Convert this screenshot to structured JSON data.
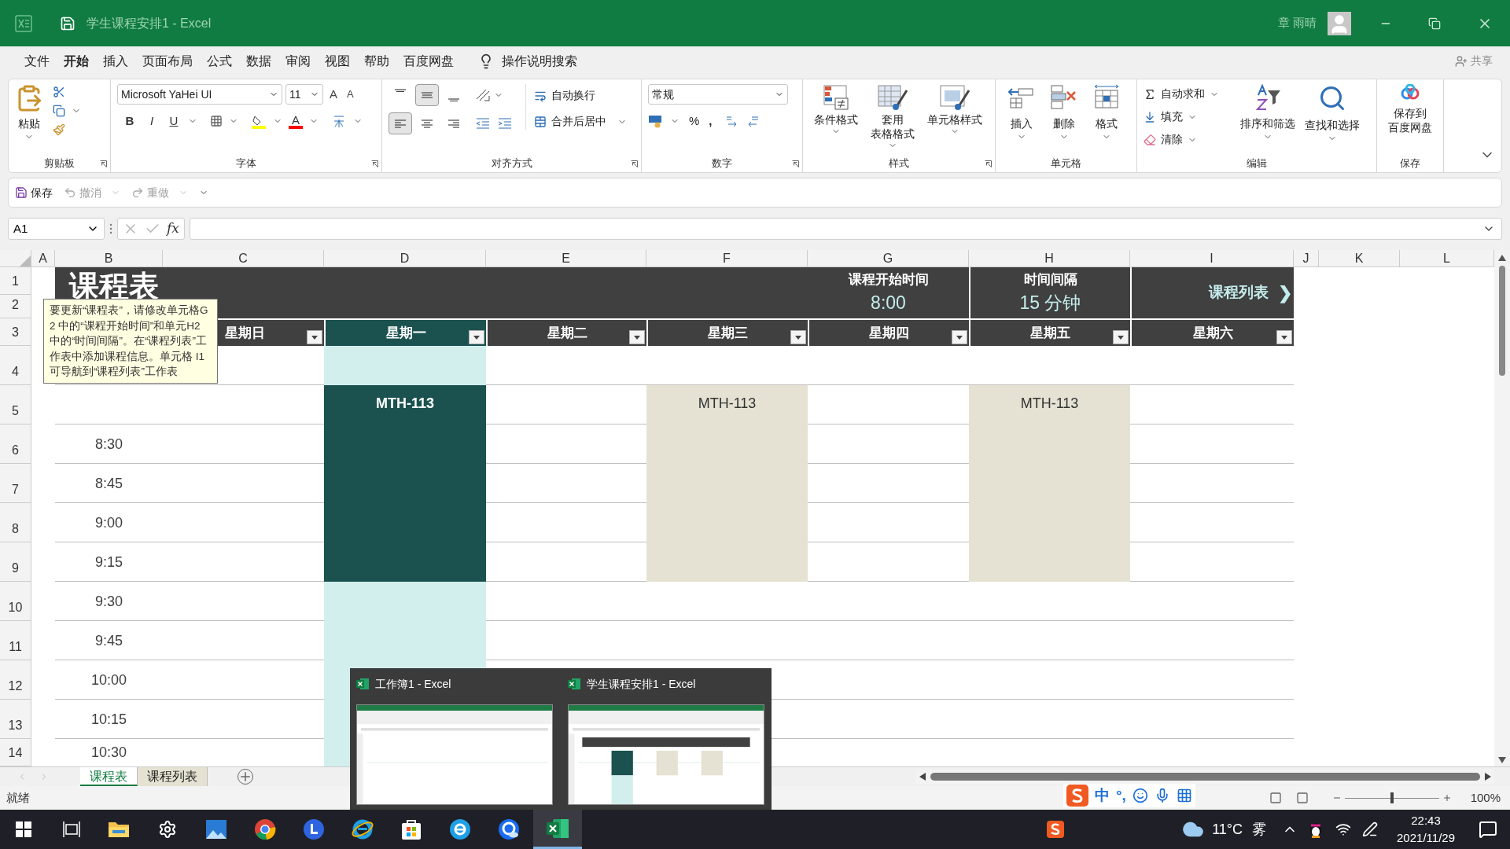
{
  "title_bar": {
    "title": "学生课程安排1 - Excel",
    "user": "章 雨晴"
  },
  "menu": [
    {
      "label": "文件",
      "selected": false
    },
    {
      "label": "开始",
      "selected": true
    },
    {
      "label": "插入",
      "selected": false
    },
    {
      "label": "页面布局",
      "selected": false
    },
    {
      "label": "公式",
      "selected": false
    },
    {
      "label": "数据",
      "selected": false
    },
    {
      "label": "审阅",
      "selected": false
    },
    {
      "label": "视图",
      "selected": false
    },
    {
      "label": "帮助",
      "selected": false
    },
    {
      "label": "百度网盘",
      "selected": false
    }
  ],
  "search": {
    "placeholder": "操作说明搜索"
  },
  "share": "共享",
  "ribbon": {
    "clipboard": {
      "paste": "粘贴",
      "group": "剪贴板"
    },
    "font": {
      "name": "Microsoft YaHei UI",
      "size": "11",
      "grow": "A",
      "shrink": "A",
      "styles": [
        "B",
        "I",
        "U"
      ],
      "color_button": "A",
      "group": "字体"
    },
    "alignment": {
      "vertical": [
        {
          "kind": "top",
          "selected": false
        },
        {
          "kind": "middle",
          "selected": true
        },
        {
          "kind": "bottom",
          "selected": false
        }
      ],
      "horizontal": [
        {
          "kind": "left",
          "selected": true
        },
        {
          "kind": "center",
          "selected": false
        },
        {
          "kind": "right",
          "selected": false
        }
      ],
      "wrap": "自动换行",
      "merge": "合并后居中",
      "group": "对齐方式"
    },
    "number": {
      "format": "常规",
      "percent": "%",
      "comma": ",",
      "group": "数字"
    },
    "styles": {
      "buttons": [
        {
          "kind": "conditional",
          "lines": [
            "条件格式"
          ]
        },
        {
          "kind": "table",
          "lines": [
            "套用",
            "表格格式"
          ]
        },
        {
          "kind": "cell",
          "lines": [
            "单元格样式"
          ]
        }
      ],
      "group": "样式"
    },
    "cells": {
      "buttons": [
        {
          "kind": "insert",
          "label": "插入"
        },
        {
          "kind": "delete",
          "label": "删除"
        },
        {
          "kind": "format",
          "label": "格式"
        }
      ],
      "group": "单元格"
    },
    "editing": {
      "small": [
        {
          "kind": "sum",
          "label": "自动求和"
        },
        {
          "kind": "fill",
          "label": "填充"
        },
        {
          "kind": "clear",
          "label": "清除"
        }
      ],
      "big": [
        {
          "kind": "sort",
          "label": "排序和筛选"
        },
        {
          "kind": "find",
          "label": "查找和选择"
        }
      ],
      "group": "编辑"
    },
    "save": {
      "lines": [
        "保存到",
        "百度网盘"
      ],
      "group": "保存"
    }
  },
  "quick_access": [
    {
      "kind": "save",
      "label": "保存",
      "disabled": false
    },
    {
      "kind": "undo",
      "label": "撤消",
      "disabled": true
    },
    {
      "kind": "redo",
      "label": "重做",
      "disabled": true
    }
  ],
  "formula_bar": {
    "name_box": "A1",
    "function_label": "fx"
  },
  "sheet": {
    "columns": [
      "A",
      "B",
      "C",
      "D",
      "E",
      "F",
      "G",
      "H",
      "I",
      "J",
      "K",
      "L"
    ],
    "rows": [
      "1",
      "2",
      "3",
      "4",
      "5",
      "6",
      "7",
      "8",
      "9",
      "10",
      "11",
      "12",
      "13",
      "14"
    ],
    "title": "课程表",
    "start_time": {
      "label": "课程开始时间",
      "value": "8:00"
    },
    "interval": {
      "label": "时间间隔",
      "value": "15 分钟"
    },
    "link": {
      "label": "课程列表",
      "arrow": "❯"
    },
    "days": [
      {
        "label": "星期日",
        "selected": false
      },
      {
        "label": "星期一",
        "selected": true,
        "events": [
          {
            "label": "MTH-113"
          }
        ]
      },
      {
        "label": "星期二",
        "selected": false
      },
      {
        "label": "星期三",
        "selected": false,
        "events": [
          {
            "label": "MTH-113"
          }
        ]
      },
      {
        "label": "星期四",
        "selected": false
      },
      {
        "label": "星期五",
        "selected": false,
        "events": [
          {
            "label": "MTH-113"
          }
        ]
      },
      {
        "label": "星期六",
        "selected": false
      }
    ],
    "times": [
      "8:30",
      "8:45",
      "9:00",
      "9:15",
      "9:30",
      "9:45",
      "10:00",
      "10:15",
      "10:30"
    ],
    "comment": "要更新“课程表”，请修改单元格G2 中的“课程开始时间”和单元H2\n中的“时间间隔”。在“课程列表”工作表中添加课程信息。单元格 I1\n可导航到“课程列表”工作表"
  },
  "sheet_tabs": [
    {
      "label": "课程表",
      "selected": true
    },
    {
      "label": "课程列表",
      "selected": false
    }
  ],
  "status_bar": {
    "status": "就绪",
    "zoom": {
      "label": "100%",
      "level": 0.5
    }
  },
  "ime": {
    "mode": "中",
    "punctuation": "°,"
  },
  "taskbar_previews": [
    {
      "title": "工作簿1 - Excel"
    },
    {
      "title": "学生课程安排1 - Excel"
    }
  ],
  "taskbar": {
    "apps": [
      {
        "kind": "explorer",
        "selected": false
      },
      {
        "kind": "settings",
        "selected": false
      },
      {
        "kind": "photos",
        "selected": false
      },
      {
        "kind": "chrome",
        "selected": false
      },
      {
        "kind": "lapp",
        "selected": false
      },
      {
        "kind": "ie",
        "selected": false
      },
      {
        "kind": "store",
        "selected": false
      },
      {
        "kind": "edge",
        "selected": false
      },
      {
        "kind": "qbrowser",
        "selected": false
      },
      {
        "kind": "excel",
        "selected": true
      }
    ],
    "weather": {
      "temperature": "11°C",
      "condition": "雾"
    },
    "time": "22:43",
    "date": "2021/11/29"
  }
}
